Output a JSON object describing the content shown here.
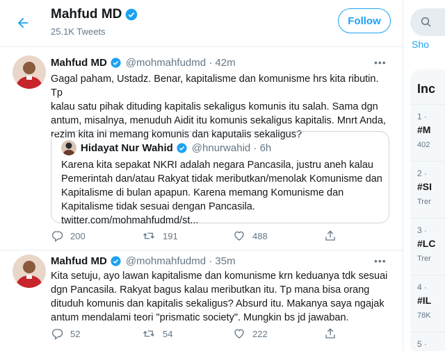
{
  "header": {
    "name": "Mahfud MD",
    "tweet_count": "25.1K Tweets",
    "follow_label": "Follow"
  },
  "tweets": [
    {
      "name": "Mahfud MD",
      "handle": "@mohmahfudmd · 42m",
      "text": "Gagal paham, Ustadz. Benar, kapitalisme dan komunisme hrs kita ributin. Tp\nkalau satu pihak dituding kapitalis sekaligus komunis itu salah. Sama dgn\nantum, misalnya, menuduh Aidit itu komunis sekaligus kapitalis. Mnrt Anda,\nrezim kita ini memang komunis dan kaputalis sekaligus?",
      "quote": {
        "name": "Hidayat Nur Wahid",
        "handle": "@hnurwahid · 6h",
        "text": "Karena kita sepakat NKRI adalah negara Pancasila, justru aneh kalau\nPemerintah dan/atau Rakyat tidak meributkan/menolak Komunisme dan\nKapitalisme di bulan apapun. Karena memang Komunisme dan\nKapitalisme tidak sesuai dengan Pancasila.\ntwitter.com/mohmahfudmd/st..."
      },
      "replies": "200",
      "retweets": "191",
      "likes": "488"
    },
    {
      "name": "Mahfud MD",
      "handle": "@mohmahfudmd · 35m",
      "text": "Kita setuju, ayo lawan kapitalisme dan komunisme krn keduanya tdk sesuai\ndgn Pancasila. Rakyat bagus kalau meributkan itu. Tp mana bisa orang\ndituduh komunis dan kapitalis sekaligus? Absurd itu. Makanya saya ngajak\nantum mendalami teori \"prismatic society\". Mungkin bs jd jawaban.",
      "replies": "52",
      "retweets": "54",
      "likes": "222"
    }
  ],
  "sidebar": {
    "search_placeholder": "Q",
    "show_link": "Sho",
    "panel_title": "Inc",
    "trends": [
      {
        "rank": "1 ·",
        "tag": "#M",
        "sub": "402"
      },
      {
        "rank": "2 ·",
        "tag": "#SI",
        "sub": "Trer"
      },
      {
        "rank": "3 ·",
        "tag": "#LC",
        "sub": "Trer"
      },
      {
        "rank": "4 ·",
        "tag": "#IL",
        "sub": "78K"
      },
      {
        "rank": "5 ·",
        "tag": "",
        "sub": ""
      }
    ]
  },
  "colors": {
    "accent": "#1da1f2",
    "secondary_text": "#657786",
    "border": "#e6ecf0"
  }
}
